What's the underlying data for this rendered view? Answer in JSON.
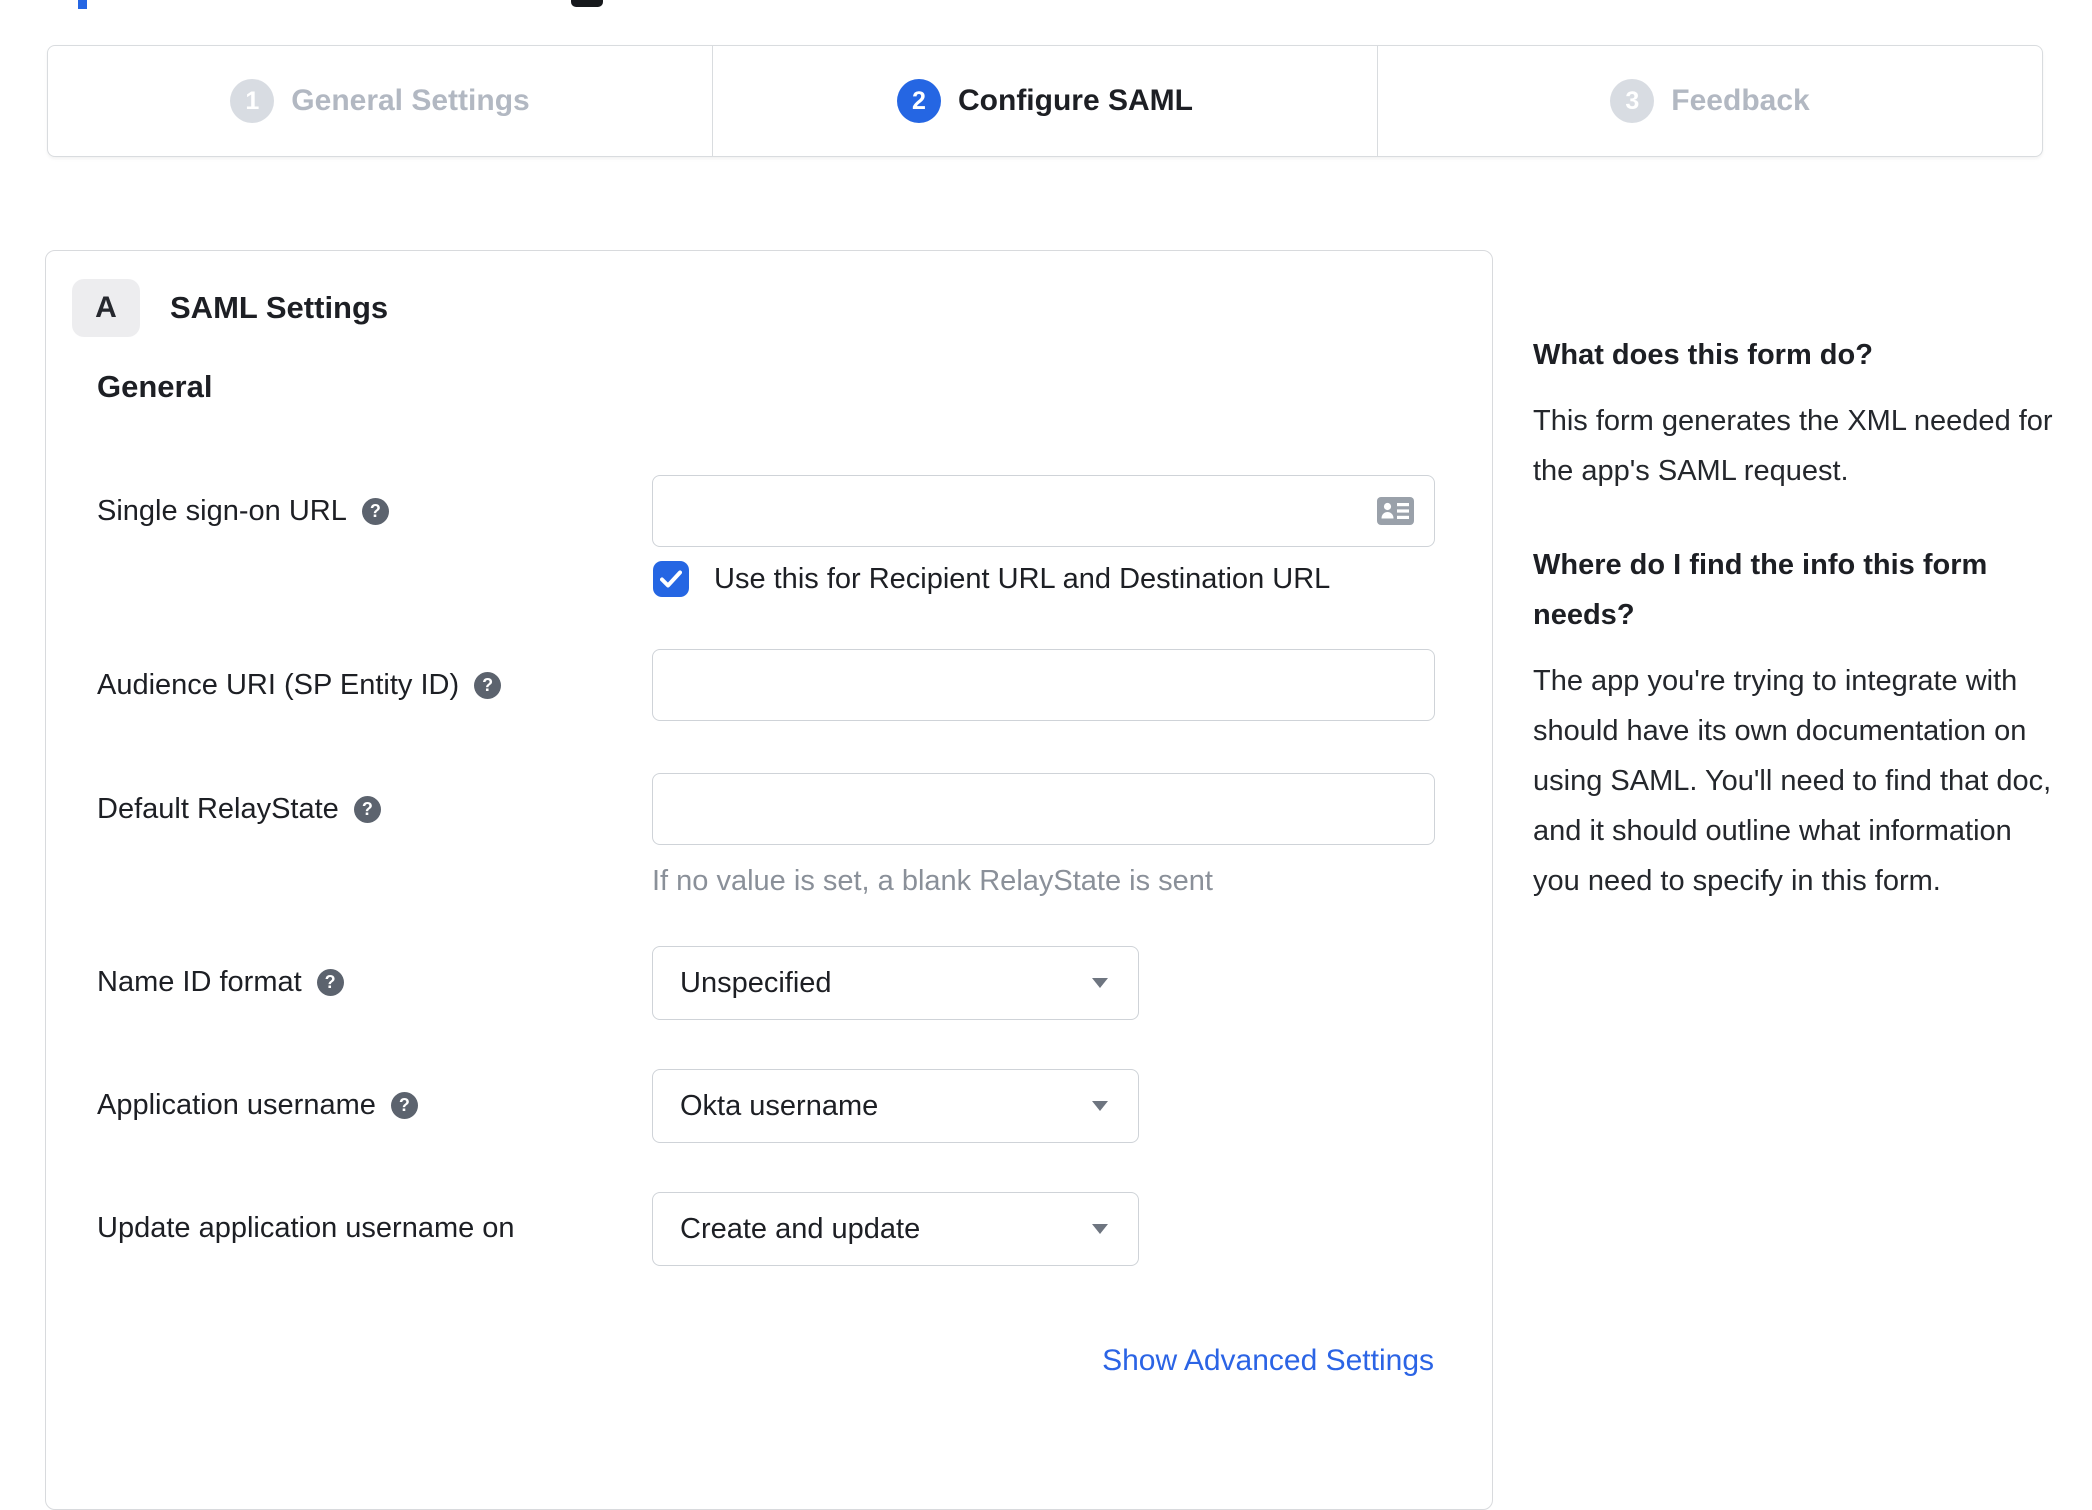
{
  "stepper": {
    "steps": [
      {
        "number": "1",
        "label": "General Settings",
        "active": false
      },
      {
        "number": "2",
        "label": "Configure SAML",
        "active": true
      },
      {
        "number": "3",
        "label": "Feedback",
        "active": false
      }
    ]
  },
  "panel": {
    "badge": "A",
    "title": "SAML Settings",
    "section_heading": "General",
    "fields": {
      "sso_url": {
        "label": "Single sign-on URL",
        "value": "",
        "checkbox_label": "Use this for Recipient URL and Destination URL",
        "checkbox_checked": true
      },
      "audience_uri": {
        "label": "Audience URI (SP Entity ID)",
        "value": ""
      },
      "relay_state": {
        "label": "Default RelayState",
        "value": "",
        "hint": "If no value is set, a blank RelayState is sent"
      },
      "name_id": {
        "label": "Name ID format",
        "value": "Unspecified"
      },
      "app_username": {
        "label": "Application username",
        "value": "Okta username"
      },
      "update_username": {
        "label": "Update application username on",
        "value": "Create and update"
      }
    },
    "advanced_link": "Show Advanced Settings"
  },
  "sidebar": {
    "sections": [
      {
        "heading": "What does this form do?",
        "body": "This form generates the XML needed for the app's SAML request."
      },
      {
        "heading": "Where do I find the info this form needs?",
        "body": "The app you're trying to integrate with should have its own documentation on using SAML. You'll need to find that doc, and it should outline what information you need to specify in this form."
      }
    ]
  },
  "icons": {
    "help": "?",
    "contact_card": "contact-card-icon",
    "checkbox_check": "checkmark",
    "dropdown": "caret-down"
  },
  "colors": {
    "accent_blue": "#2566e3",
    "link_blue": "#2b64e5",
    "inactive_circle_gray": "#d8dce2",
    "inactive_label_gray": "#b2b8c2",
    "text_dark": "#1d1f24",
    "hint_gray": "#8a9099",
    "border_gray": "#cfd3d8"
  }
}
